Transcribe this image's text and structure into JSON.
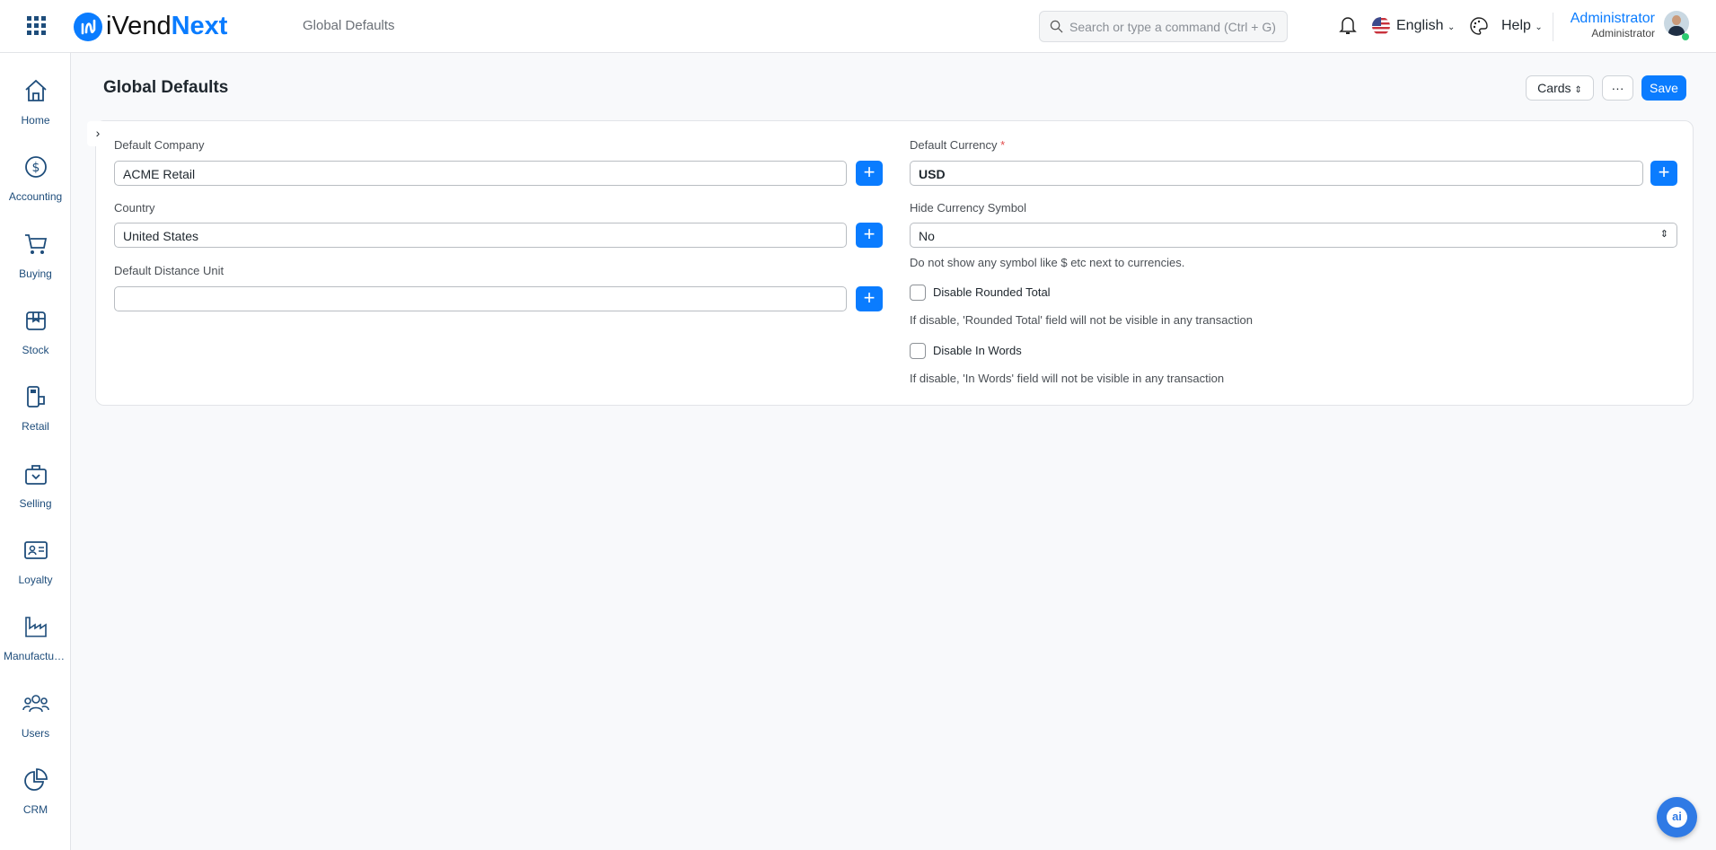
{
  "header": {
    "app_name_part1": "iVend",
    "app_name_part2": "Next",
    "breadcrumb": "Global Defaults",
    "search_placeholder": "Search or type a command (Ctrl + G)",
    "language": "English",
    "help": "Help",
    "user_name": "Administrator",
    "user_role": "Administrator",
    "brand_color": "#0a7cff"
  },
  "sidebar": {
    "items": [
      {
        "label": "Home",
        "icon": "home-icon"
      },
      {
        "label": "Accounting",
        "icon": "dollar-icon"
      },
      {
        "label": "Buying",
        "icon": "cart-icon"
      },
      {
        "label": "Stock",
        "icon": "box-icon"
      },
      {
        "label": "Retail",
        "icon": "pos-icon"
      },
      {
        "label": "Selling",
        "icon": "bag-icon"
      },
      {
        "label": "Loyalty",
        "icon": "id-card-icon"
      },
      {
        "label": "Manufacturing",
        "icon": "factory-icon"
      },
      {
        "label": "Users",
        "icon": "users-icon"
      },
      {
        "label": "CRM",
        "icon": "pie-chart-icon"
      }
    ]
  },
  "page": {
    "title": "Global Defaults",
    "view_select": "Cards",
    "more_label": "···",
    "save_label": "Save"
  },
  "form": {
    "default_company": {
      "label": "Default Company",
      "value": "ACME Retail"
    },
    "country": {
      "label": "Country",
      "value": "United States"
    },
    "default_distance_unit": {
      "label": "Default Distance Unit",
      "value": ""
    },
    "default_currency": {
      "label": "Default Currency",
      "required": "*",
      "value": "USD"
    },
    "hide_currency_symbol": {
      "label": "Hide Currency Symbol",
      "value": "No",
      "help": "Do not show any symbol like $ etc next to currencies."
    },
    "disable_rounded_total": {
      "label": "Disable Rounded Total",
      "checked": false,
      "help": "If disable, 'Rounded Total' field will not be visible in any transaction"
    },
    "disable_in_words": {
      "label": "Disable In Words",
      "checked": false,
      "help": "If disable, 'In Words' field will not be visible in any transaction"
    }
  },
  "assistant": {
    "label": "ai"
  }
}
